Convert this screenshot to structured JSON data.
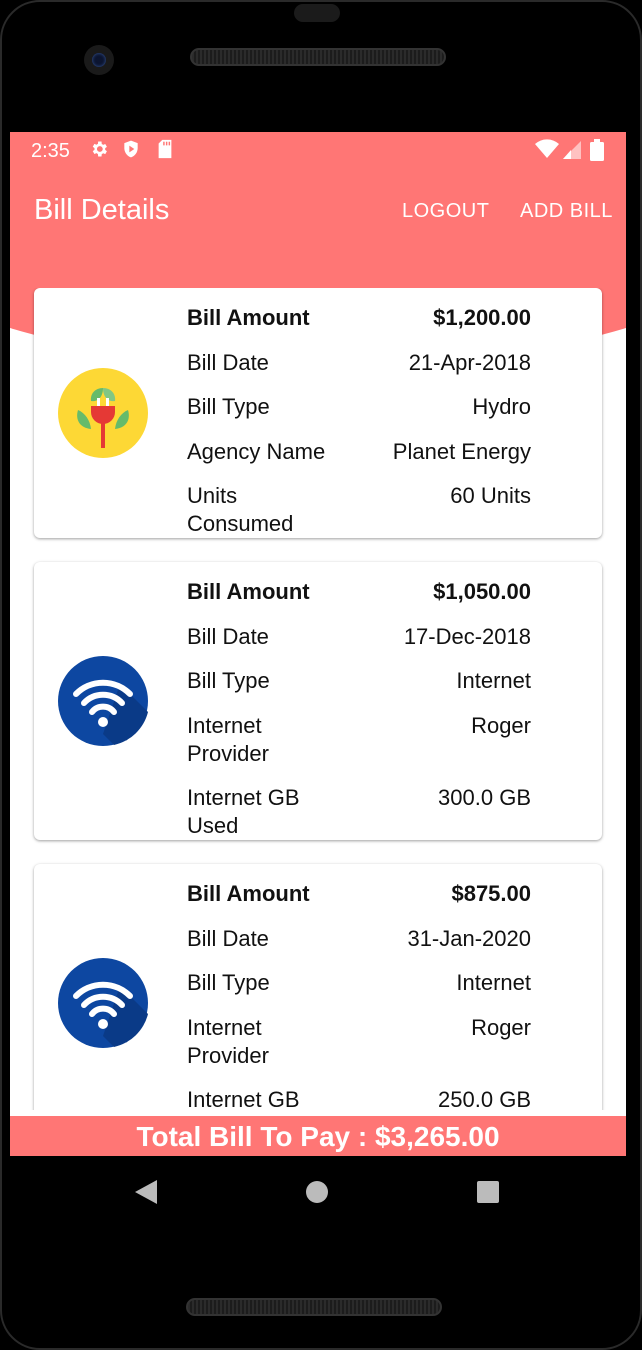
{
  "status_bar": {
    "time": "2:35"
  },
  "app_bar": {
    "title": "Bill Details",
    "logout_label": "LOGOUT",
    "add_bill_label": "ADD BILL"
  },
  "bills": [
    {
      "icon": "hydro-plug-icon",
      "amount_label": "Bill Amount",
      "amount": "$1,200.00",
      "date_label": "Bill Date",
      "date": "21-Apr-2018",
      "type_label": "Bill Type",
      "type": "Hydro",
      "provider_label": "Agency Name",
      "provider": "Planet Energy",
      "usage_label": "Units Consumed",
      "usage": "60 Units"
    },
    {
      "icon": "wifi-icon",
      "amount_label": "Bill Amount",
      "amount": "$1,050.00",
      "date_label": "Bill Date",
      "date": "17-Dec-2018",
      "type_label": "Bill Type",
      "type": "Internet",
      "provider_label": "Internet Provider",
      "provider": "Roger",
      "usage_label": "Internet GB Used",
      "usage": "300.0 GB"
    },
    {
      "icon": "wifi-icon",
      "amount_label": "Bill Amount",
      "amount": "$875.00",
      "date_label": "Bill Date",
      "date": "31-Jan-2020",
      "type_label": "Bill Type",
      "type": "Internet",
      "provider_label": "Internet Provider",
      "provider": "Roger",
      "usage_label": "Internet GB Used",
      "usage": "250.0 GB"
    }
  ],
  "footer": {
    "total_text": "Total Bill To Pay : $3,265.00"
  },
  "colors": {
    "accent": "#ff7675",
    "wifi_blue": "#0d47a1",
    "hydro_yellow": "#fdd835"
  }
}
